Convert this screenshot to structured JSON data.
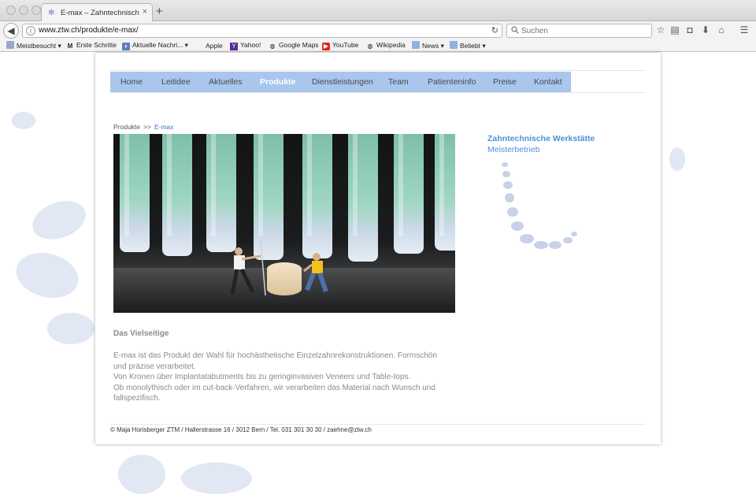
{
  "browser": {
    "tab_title": "E-max – Zahntechnische ...",
    "tab_close": "×",
    "new_tab": "+",
    "url": "www.ztw.ch/produkte/e-max/",
    "search_placeholder": "Suchen",
    "bookmarks": [
      {
        "label": "Meistbesucht ▾",
        "icon": "bookmark-folder-icon"
      },
      {
        "label": "Erste Schritte",
        "icon": "m-icon"
      },
      {
        "label": "Aktuelle Nachri... ▾",
        "icon": "rss-icon"
      },
      {
        "label": "Apple",
        "icon": "apple-icon"
      },
      {
        "label": "Yahoo!",
        "icon": "yahoo-icon"
      },
      {
        "label": "Google Maps",
        "icon": "globe-icon"
      },
      {
        "label": "YouTube",
        "icon": "youtube-icon"
      },
      {
        "label": "Wikipedia",
        "icon": "globe-icon"
      },
      {
        "label": "News ▾",
        "icon": "folder-icon"
      },
      {
        "label": "Beliebt ▾",
        "icon": "folder-icon"
      }
    ]
  },
  "nav": {
    "items": [
      "Home",
      "Leitidee",
      "Aktuelles",
      "Produkte",
      "Dienstleistungen",
      "Team",
      "Patienteninfo",
      "Preise",
      "Kontakt"
    ],
    "active": "Produkte"
  },
  "breadcrumb": {
    "parent": "Produkte",
    "separator": ">>",
    "current": "E-max"
  },
  "content": {
    "title": "Das Vielseitige",
    "paragraphs": [
      "E-max ist das Produkt der Wahl für hochästhetische Einzelzahnrekonstruktionen. Formschön und präzise verarbeitet.",
      "Von Kronen über Implantatabutments bis zu geringinvasiven Veneers und Table-tops.",
      "Ob monolythisch oder im cut-back-Verfahren, wir verarbeiten das Material nach Wunsch und fallspezifisch."
    ]
  },
  "sidebar": {
    "title": "Zahntechnische Werkstätte",
    "subtitle": "Meisterbetrieb"
  },
  "footer": {
    "text": "© Maja Horisberger ZTM / Hallerstrasse 16 / 3012 Bern / Tel. 031 301 30 30 / zaehne@ztw.ch"
  },
  "colors": {
    "nav_bg": "#a9c6ed",
    "accent": "#4f8fd8",
    "body_text": "#8a8a8a"
  }
}
